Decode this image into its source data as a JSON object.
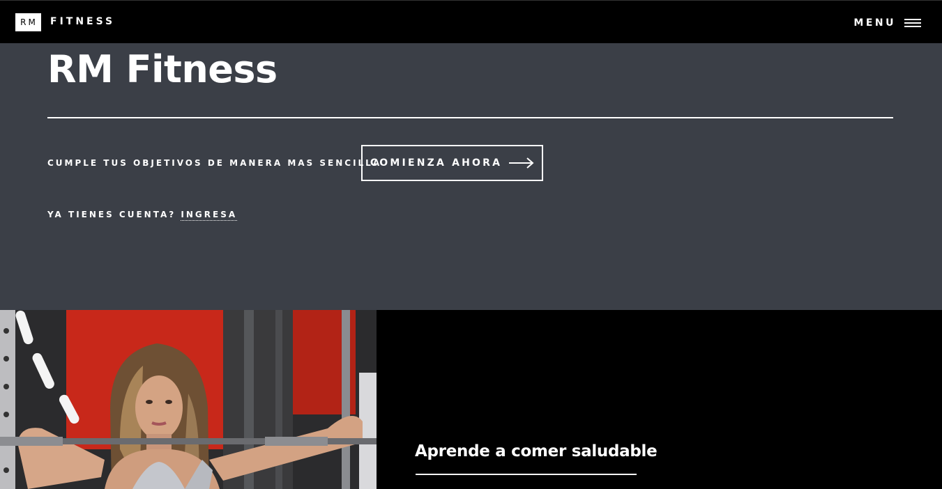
{
  "header": {
    "logo_mark": "RM",
    "logo_text": "FITNESS",
    "menu_label": "MENU"
  },
  "hero": {
    "title": "RM Fitness",
    "tagline": "CUMPLE TUS OBJETIVOS DE MANERA MAS SENCILLA",
    "cta_label": "COMIENZA AHORA",
    "account_prompt": "YA TIENES CUENTA?",
    "login_label": "INGRESA"
  },
  "feature": {
    "heading": "Aprende a comer saludable"
  },
  "colors": {
    "topbar": "#000000",
    "hero_bg": "#3b3f47",
    "text": "#ffffff",
    "gym_red": "#c8281a"
  },
  "icons": {
    "menu": "hamburger-icon",
    "cta": "arrow-right-icon"
  }
}
